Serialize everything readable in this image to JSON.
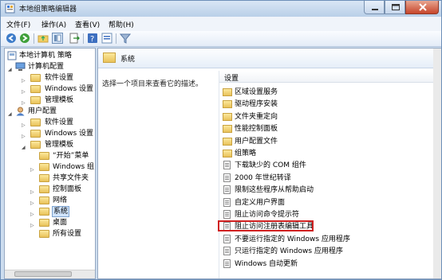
{
  "window": {
    "title": "本地组策略编辑器"
  },
  "menu": {
    "file": "文件(F)",
    "action": "操作(A)",
    "view": "查看(V)",
    "help": "帮助(H)"
  },
  "toolbar_icons": [
    "back-arrow-icon",
    "forward-arrow-icon",
    "up-folder-icon",
    "show-tree-icon",
    "export-icon",
    "help-icon",
    "properties-icon",
    "filter-icon"
  ],
  "tree": {
    "root": "本地计算机 策略",
    "computer_config": "计算机配置",
    "c_software": "软件设置",
    "c_windows": "Windows 设置",
    "c_admin": "管理模板",
    "user_config": "用户配置",
    "u_software": "软件设置",
    "u_windows": "Windows 设置",
    "u_admin": "管理模板",
    "start_menu": "“开始”菜单",
    "windows_comp": "Windows 组",
    "shared_folders": "共享文件夹",
    "control_panel": "控制面板",
    "network": "网络",
    "system": "系统",
    "desktop": "桌面",
    "all_settings": "所有设置"
  },
  "right": {
    "header": "系统",
    "description": "选择一个项目来查看它的描述。",
    "column": "设置",
    "items": [
      {
        "label": "区域设置服务",
        "type": "folder"
      },
      {
        "label": "驱动程序安装",
        "type": "folder"
      },
      {
        "label": "文件夹重定向",
        "type": "folder"
      },
      {
        "label": "性能控制面板",
        "type": "folder"
      },
      {
        "label": "用户配置文件",
        "type": "folder"
      },
      {
        "label": "组策略",
        "type": "folder"
      },
      {
        "label": "下载缺少的 COM 组件",
        "type": "setting"
      },
      {
        "label": "2000 年世纪转译",
        "type": "setting"
      },
      {
        "label": "限制这些程序从帮助启动",
        "type": "setting"
      },
      {
        "label": "自定义用户界面",
        "type": "setting"
      },
      {
        "label": "阻止访问命令提示符",
        "type": "setting"
      },
      {
        "label": "阻止访问注册表编辑工具",
        "type": "setting"
      },
      {
        "label": "不要运行指定的 Windows 应用程序",
        "type": "setting"
      },
      {
        "label": "只运行指定的 Windows 应用程序",
        "type": "setting"
      },
      {
        "label": "Windows 自动更新",
        "type": "setting"
      }
    ]
  }
}
